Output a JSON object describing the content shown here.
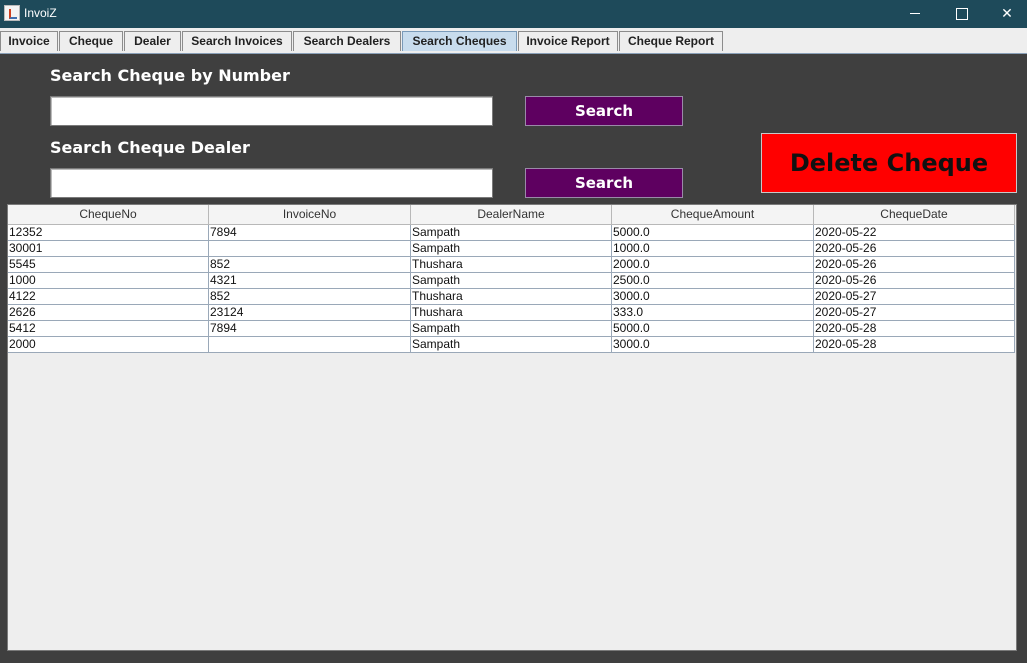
{
  "window": {
    "title": "InvoiZ",
    "controls": {
      "minimize_icon": "minimize-icon",
      "maximize_icon": "maximize-icon",
      "close_icon": "close-icon",
      "close_glyph": "✕"
    }
  },
  "tabs": [
    {
      "label": "Invoice",
      "active": false
    },
    {
      "label": "Cheque",
      "active": false
    },
    {
      "label": "Dealer",
      "active": false
    },
    {
      "label": "Search Invoices",
      "active": false
    },
    {
      "label": "Search Dealers",
      "active": false
    },
    {
      "label": "Search Cheques",
      "active": true
    },
    {
      "label": "Invoice Report",
      "active": false
    },
    {
      "label": "Cheque Report",
      "active": false
    }
  ],
  "search_by_number": {
    "label": "Search Cheque by Number",
    "value": "",
    "button": "Search"
  },
  "search_by_dealer": {
    "label": "Search Cheque Dealer",
    "value": "",
    "button": "Search"
  },
  "delete_button": {
    "label": "Delete Cheque",
    "color": "#ff0000"
  },
  "colors": {
    "search_button": "#5e0060",
    "background": "#3f3f3f",
    "titlebar": "#1e4a5a"
  },
  "table": {
    "columns": [
      "ChequeNo",
      "InvoiceNo",
      "DealerName",
      "ChequeAmount",
      "ChequeDate"
    ],
    "rows": [
      [
        "12352",
        "7894",
        "Sampath",
        "5000.0",
        "2020-05-22"
      ],
      [
        "30001",
        "",
        "Sampath",
        "1000.0",
        "2020-05-26"
      ],
      [
        "5545",
        "852",
        "Thushara",
        "2000.0",
        "2020-05-26"
      ],
      [
        "1000",
        "4321",
        "Sampath",
        "2500.0",
        "2020-05-26"
      ],
      [
        "4122",
        "852",
        "Thushara",
        "3000.0",
        "2020-05-27"
      ],
      [
        "2626",
        "23124",
        "Thushara",
        "333.0",
        "2020-05-27"
      ],
      [
        "5412",
        "7894",
        "Sampath",
        "5000.0",
        "2020-05-28"
      ],
      [
        "2000",
        "",
        "Sampath",
        "3000.0",
        "2020-05-28"
      ]
    ]
  }
}
